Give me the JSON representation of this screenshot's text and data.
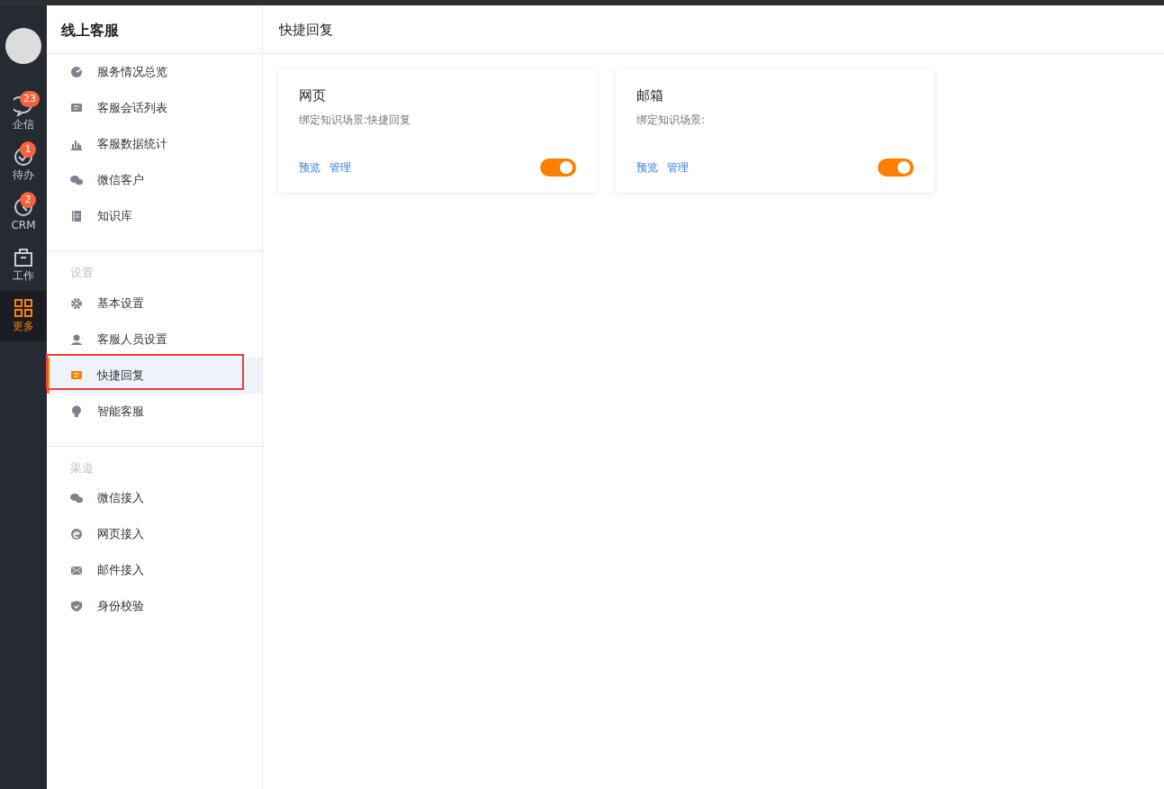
{
  "rail": {
    "items": [
      {
        "kind": "chat",
        "label": "企信",
        "badge": "23",
        "selected": false
      },
      {
        "kind": "todo",
        "label": "待办",
        "badge": "1",
        "selected": false
      },
      {
        "kind": "clock",
        "label": "CRM",
        "badge": "2",
        "selected": false
      },
      {
        "kind": "work",
        "label": "工作",
        "selected": false
      },
      {
        "kind": "grid",
        "label": "更多",
        "selected": true
      }
    ]
  },
  "sidebar": {
    "title": "线上客服",
    "sections": [
      {
        "items": [
          {
            "kind": "pie",
            "label": "服务情况总览",
            "selected": false
          },
          {
            "kind": "chat",
            "label": "客服会话列表",
            "selected": false
          },
          {
            "kind": "bars",
            "label": "客服数据统计",
            "selected": false
          },
          {
            "kind": "wechat",
            "label": "微信客户",
            "selected": false
          },
          {
            "kind": "book",
            "label": "知识库",
            "selected": false
          }
        ]
      },
      {
        "heading": "设置",
        "items": [
          {
            "kind": "gear",
            "label": "基本设置",
            "selected": false
          },
          {
            "kind": "agent",
            "label": "客服人员设置",
            "selected": false
          },
          {
            "kind": "chat",
            "label": "快捷回复",
            "selected": true,
            "annotated": true
          },
          {
            "kind": "bulb",
            "label": "智能客服",
            "selected": false
          }
        ]
      },
      {
        "heading": "渠道",
        "items": [
          {
            "kind": "wechat",
            "label": "微信接入",
            "selected": false
          },
          {
            "kind": "ie",
            "label": "网页接入",
            "selected": false
          },
          {
            "kind": "mail",
            "label": "邮件接入",
            "selected": false
          },
          {
            "kind": "shield",
            "label": "身份校验",
            "selected": false
          }
        ]
      }
    ]
  },
  "main": {
    "title": "快捷回复",
    "cards": [
      {
        "title": "网页",
        "scene": "绑定知识场景:快捷回复",
        "links": [
          "预览",
          "管理"
        ],
        "on": true
      },
      {
        "title": "邮箱",
        "scene": "绑定知识场景:",
        "links": [
          "预览",
          "管理"
        ],
        "on": true
      }
    ]
  }
}
